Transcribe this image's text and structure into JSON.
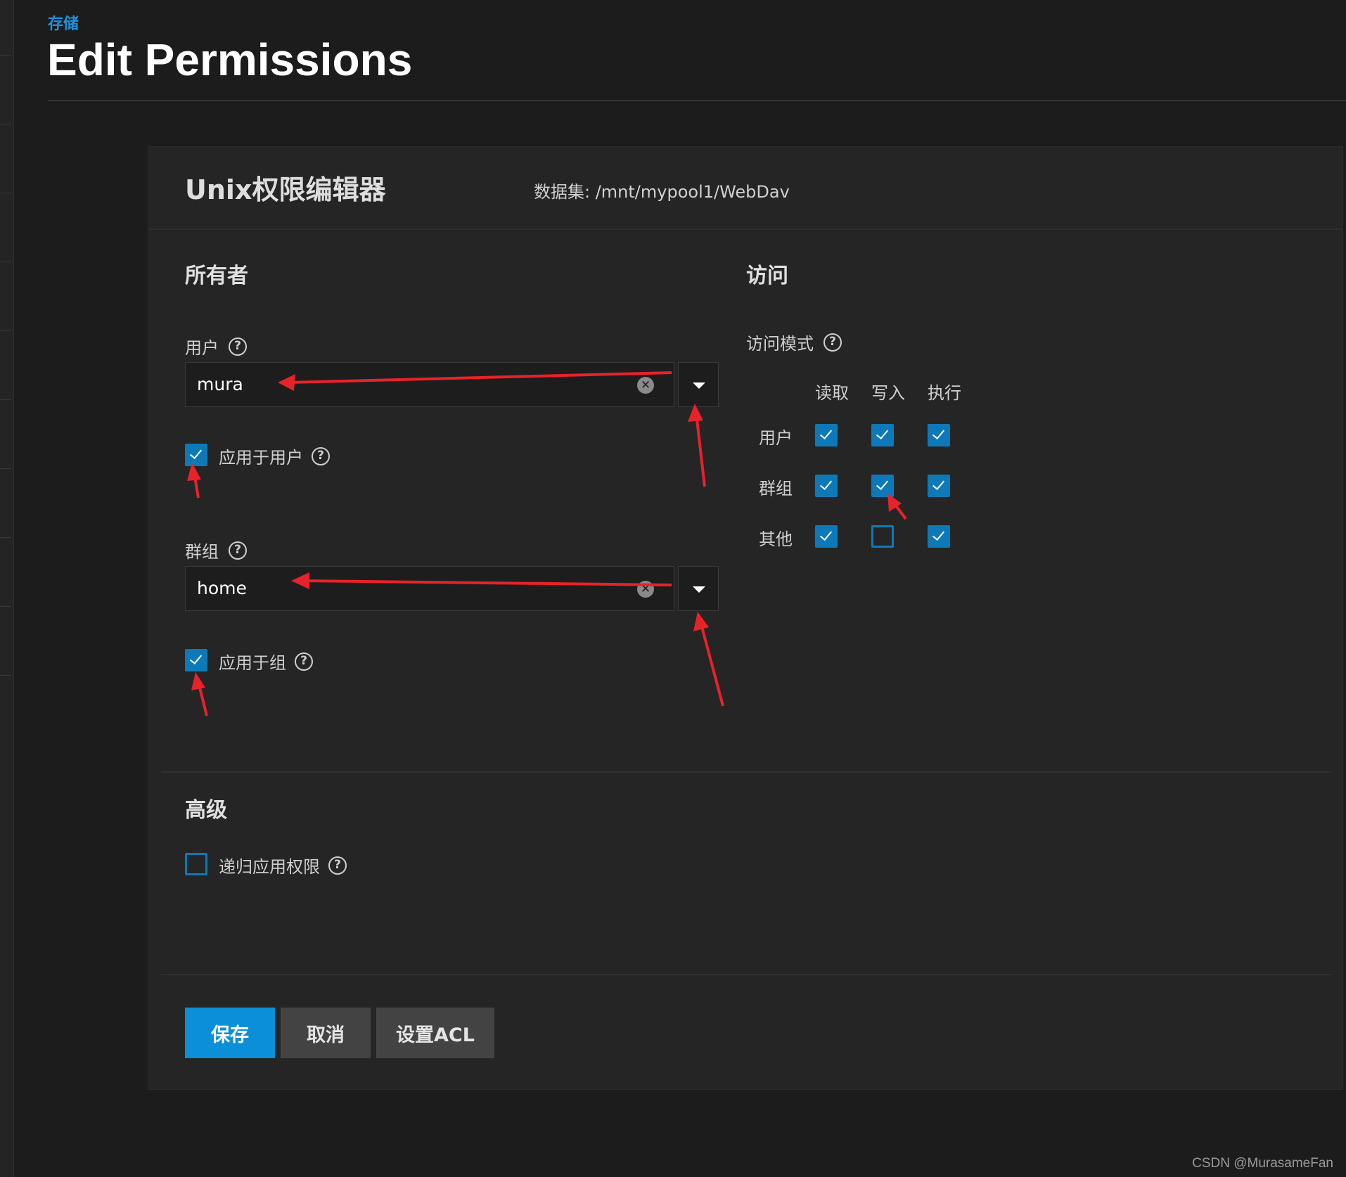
{
  "breadcrumb": "存储",
  "page_title": "Edit Permissions",
  "card": {
    "title": "Unix权限编辑器",
    "dataset_label": "数据集:  /mnt/mypool1/WebDav"
  },
  "owner": {
    "section_title": "所有者",
    "user_label": "用户",
    "user_value": "mura",
    "apply_user_label": "应用于用户",
    "apply_user_checked": true,
    "group_label": "群组",
    "group_value": "home",
    "apply_group_label": "应用于组",
    "apply_group_checked": true
  },
  "access": {
    "section_title": "访问",
    "mode_label": "访问模式",
    "columns": [
      "读取",
      "写入",
      "执行"
    ],
    "rows": [
      {
        "label": "用户",
        "values": [
          true,
          true,
          true
        ]
      },
      {
        "label": "群组",
        "values": [
          true,
          true,
          true
        ]
      },
      {
        "label": "其他",
        "values": [
          true,
          false,
          true
        ]
      }
    ]
  },
  "advanced": {
    "section_title": "高级",
    "recursive_label": "递归应用权限",
    "recursive_checked": false
  },
  "buttons": {
    "save": "保存",
    "cancel": "取消",
    "set_acl": "设置ACL"
  },
  "icons": {
    "help": "help-circle-icon",
    "clear": "clear-circle-icon",
    "dropdown": "caret-down-icon",
    "check": "checkmark-icon"
  },
  "colors": {
    "accent": "#0a8fd8",
    "checkbox": "#0e79b8",
    "annotation_arrow": "#e8222a",
    "background": "#1c1c1c",
    "card": "#252525"
  },
  "watermark": "CSDN @MurasameFan"
}
